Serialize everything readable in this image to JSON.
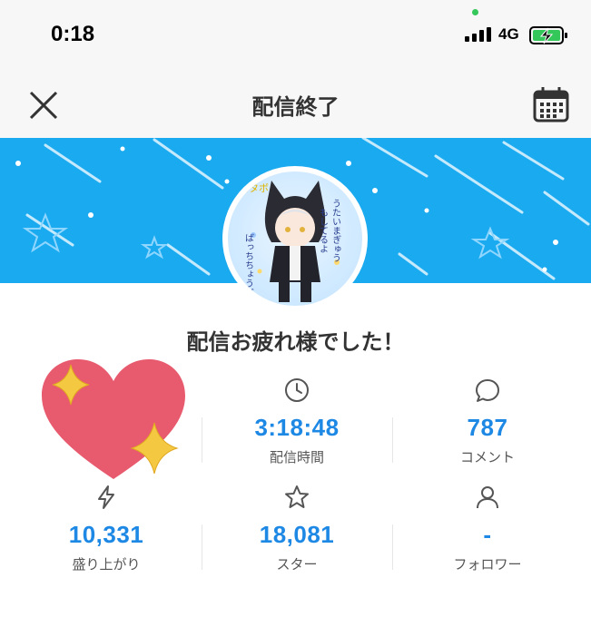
{
  "status_bar": {
    "time": "0:18",
    "network": "4G"
  },
  "nav": {
    "title": "配信終了"
  },
  "message": "配信お疲れ様でした！",
  "avatar": {
    "text_lines": [
      "ヨタボ",
      "うたいまぎゅう",
      "もしてるよ",
      "ばっちちょうだい"
    ]
  },
  "stats": {
    "duration": {
      "value": "3:18:48",
      "label": "配信時間",
      "icon": "clock-icon"
    },
    "comments": {
      "value": "787",
      "label": "コメント",
      "icon": "comment-icon"
    },
    "excitement": {
      "value": "10,331",
      "label": "盛り上がり",
      "icon": "lightning-icon"
    },
    "stars": {
      "value": "18,081",
      "label": "スター",
      "icon": "star-icon"
    },
    "followers": {
      "value": "-",
      "label": "フォロワー",
      "icon": "person-icon"
    }
  },
  "colors": {
    "banner": "#1aaaf0",
    "accent": "#1e88e5",
    "heart": "#e85a6e",
    "sparkle": "#f5c842"
  }
}
